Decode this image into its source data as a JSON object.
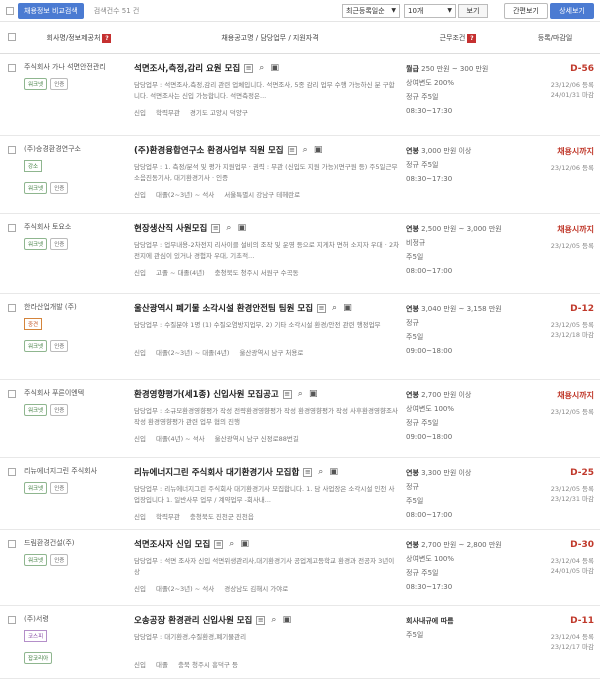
{
  "toolbar": {
    "compare_label": "채용정보 비교검색",
    "count_label": "검색건수 51 건",
    "sort_value": "최근등록일순",
    "per_page_value": "10개",
    "view_button": "보기",
    "simple_view": "간편보기",
    "detail_view": "상세보기"
  },
  "header": {
    "company": "회사명/정보제공처",
    "title": "채용공고명 / 담당업무 / 지원자격",
    "conditions": "근무조건",
    "deadline": "등록/마감일"
  },
  "rows": [
    {
      "company": "주식회사 가나 석면안전관리",
      "badge1": "워크넷",
      "badge2": "인증",
      "category": "",
      "title": "석면조사,측정,감리 요원 모집",
      "duty": "담당업무 : 석면조사,측정,감리 관련 업체입니다. 석면조사, 5종 감리 업무 수행 가능하신 분 구합니다. 석면조사는 신입 가능합니다. 석면측정은...",
      "meta1": "신입",
      "meta2": "학력무관",
      "meta3": "경기도 고양시 덕양구",
      "cond1_label": "월급",
      "cond1": "250 만원 ~ 300 만원",
      "cond2": "상여변도 200%",
      "cond3a": "정규",
      "cond3b": "주5일",
      "cond4": "08:30~17:30",
      "dday": "D-56",
      "reg": "23/12/06 등록",
      "end": "24/01/31 마감"
    },
    {
      "company": "(주)승경환경연구소",
      "badge1": "워크넷",
      "badge2": "인증",
      "category": "강소",
      "title": "(주)환경융합연구소 환경사업부 직원 모집",
      "duty": "담당업무 : 1. 측정/분석 및 평가 지원업무  · 권력 : 무관 (신입도 지원 가능)(면구원 등) 주5일근무  소음진동기사, 대기환경기사 · 인증",
      "meta1": "신입",
      "meta2": "대졸(2~3년) ~ 석사",
      "meta3": "서울특별시 강남구 테헤란로",
      "cond1_label": "연봉",
      "cond1": "3,000 만원 이상",
      "cond2": "",
      "cond3a": "정규",
      "cond3b": "주5일",
      "cond4": "08:30~17:30",
      "dday": "채용시까지",
      "reg": "23/12/06 등록",
      "end": ""
    },
    {
      "company": "주식회사 토요소",
      "badge1": "워크넷",
      "badge2": "인증",
      "category": "",
      "title": "현장생산직 사원모집",
      "duty": "담당업무 : 업무내용-2차전지 리사이클 설비의 조작 및 운영 등으로 지게차 면허 소지자 우대 · 2차전지에 관심이 있거나 경험자 우대, 기초적...",
      "meta1": "신입",
      "meta2": "고졸 ~ 대졸(4년)",
      "meta3": "충청북도 청주시 서원구 수곡동",
      "cond1_label": "연봉",
      "cond1": "2,500 만원 ~ 3,000 만원",
      "cond2": "비정규",
      "cond3a": "주5일",
      "cond3b": "",
      "cond4": "08:00~17:00",
      "dday": "채용시까지",
      "reg": "23/12/05 등록",
      "end": ""
    },
    {
      "company": "한라산업개발 (주)",
      "badge1": "워크넷",
      "badge2": "인증",
      "category": "중견",
      "title": "울산광역시 폐기물 소각시설 환경안전팀 팀원 모집",
      "duty": "담당업무 : 수질분야 1명 (1) 수질오염방지업무, 2) 기타 소각시설 환경/안전 관련 행정업무",
      "meta1": "신입",
      "meta2": "대졸(2~3년) ~ 대졸(4년)",
      "meta3": "울산광역시 남구 처용로",
      "cond1_label": "연봉",
      "cond1": "3,040 만원 ~ 3,158 만원",
      "cond2": "정규",
      "cond3a": "주5일",
      "cond3b": "",
      "cond4": "09:00~18:00",
      "dday": "D-12",
      "reg": "23/12/05 등록",
      "end": "23/12/18 마감"
    },
    {
      "company": "주식회사 푸른이엔텍",
      "badge1": "워크넷",
      "badge2": "인증",
      "category": "",
      "title": "환경영향평가(세1종) 신입사원 모집공고",
      "duty": "담당업무 : 소규모환경영향평가 작성 전략환경영향평가 작성 환경영향평가 작성 사후환경영향조사 작성 환경영향평가 관련 업무 협의 진행",
      "meta1": "신입",
      "meta2": "대졸(4년) ~ 석사",
      "meta3": "울산광역시 남구 신정로88번길",
      "cond1_label": "연봉",
      "cond1": "2,700 만원 이상",
      "cond2": "상여변도 100%",
      "cond3a": "정규",
      "cond3b": "주5일",
      "cond4": "09:00~18:00",
      "dday": "채용시까지",
      "reg": "23/12/05 등록",
      "end": ""
    },
    {
      "company": "리뉴에너지그린 주식회사",
      "badge1": "워크넷",
      "badge2": "인증",
      "category": "",
      "title": "리뉴에너지그린 주식회사 대기환경기사 모집합",
      "duty": "담당업무 : 리뉴에너지그린 주식회사 대기환경기사 모집합니다. 1. 담 사업장은 소각시설 인천 사업장입니다 1. 일반사무 업무 / 계약업무 -회사내...",
      "meta1": "신입",
      "meta2": "학력무관",
      "meta3": "충청북도 진천군 진천읍",
      "cond1_label": "연봉",
      "cond1": "3,300 만원 이상",
      "cond2": "정규",
      "cond3a": "주5일",
      "cond3b": "",
      "cond4": "08:00~17:00",
      "dday": "D-25",
      "reg": "23/12/05 등록",
      "end": "23/12/31 마감"
    },
    {
      "company": "드림환경건설(주)",
      "badge1": "워크넷",
      "badge2": "인증",
      "category": "",
      "title": "석면조사자 신입 모집",
      "duty": "담당업무 : 석면 조사자 신입 석면위생관리사,대기환경기사 공업계고등학교 환경과 전공자 3년이상",
      "meta1": "신입",
      "meta2": "대졸(2~3년) ~ 석사",
      "meta3": "경상남도 김해시 가야로",
      "cond1_label": "연봉",
      "cond1": "2,700 만원 ~ 2,800 만원",
      "cond2": "상여변도 100%",
      "cond3a": "정규",
      "cond3b": "주5일",
      "cond4": "08:30~17:30",
      "dday": "D-30",
      "reg": "23/12/04 등록",
      "end": "24/01/05 마감"
    },
    {
      "company": "(주)서령",
      "badge1": "잡코리아",
      "badge2": "",
      "category": "코스피",
      "title": "오송공장 환경관리 신입사원 모집",
      "duty": "담당업무 : 대기환경,수질환경,폐기물관리",
      "meta1": "신입",
      "meta2": "대졸",
      "meta3": "충북 청주시 흥덕구 등",
      "cond1_label": "회사내규에 따름",
      "cond1": "",
      "cond2": "주5일",
      "cond3a": "",
      "cond3b": "",
      "cond4": "",
      "dday": "D-11",
      "reg": "23/12/04 등록",
      "end": "23/12/17 마감"
    }
  ]
}
